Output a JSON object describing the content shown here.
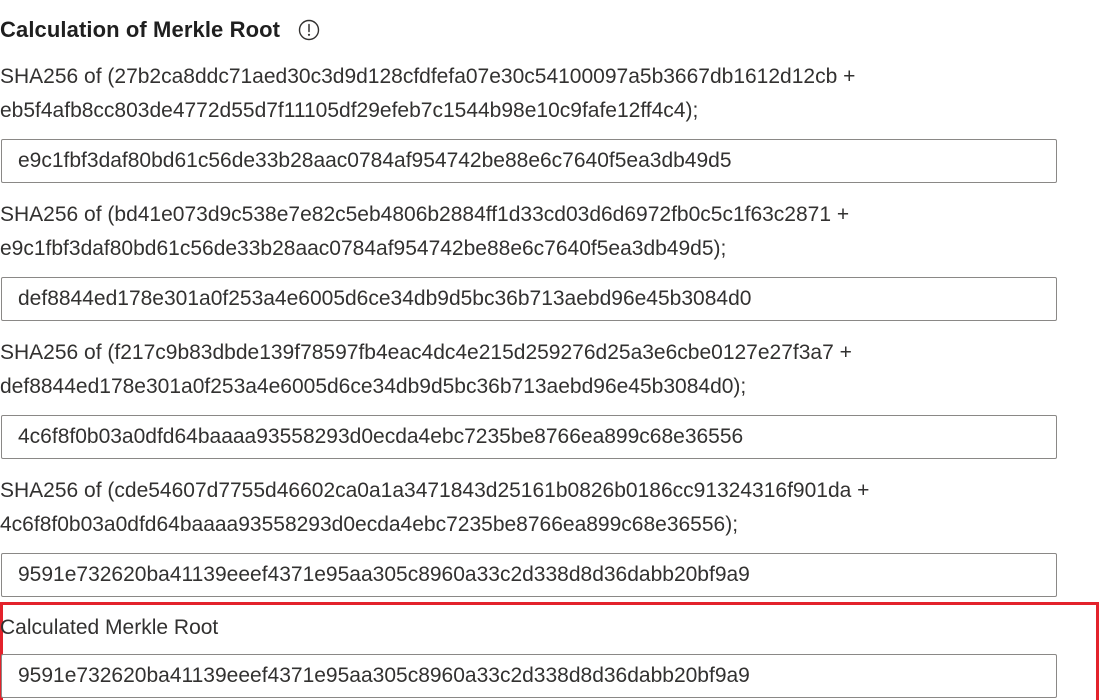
{
  "section": {
    "title": "Calculation of Merkle Root"
  },
  "steps": [
    {
      "line1": "SHA256 of (27b2ca8ddc71aed30c3d9d128cfdfefa07e30c54100097a5b3667db1612d12cb +",
      "line2": "eb5f4afb8cc803de4772d55d7f11105df29efeb7c1544b98e10c9fafe12ff4c4);",
      "result": "e9c1fbf3daf80bd61c56de33b28aac0784af954742be88e6c7640f5ea3db49d5"
    },
    {
      "line1": "SHA256 of (bd41e073d9c538e7e82c5eb4806b2884ff1d33cd03d6d6972fb0c5c1f63c2871 +",
      "line2": "e9c1fbf3daf80bd61c56de33b28aac0784af954742be88e6c7640f5ea3db49d5);",
      "result": "def8844ed178e301a0f253a4e6005d6ce34db9d5bc36b713aebd96e45b3084d0"
    },
    {
      "line1": "SHA256 of (f217c9b83dbde139f78597fb4eac4dc4e215d259276d25a3e6cbe0127e27f3a7 +",
      "line2": "def8844ed178e301a0f253a4e6005d6ce34db9d5bc36b713aebd96e45b3084d0);",
      "result": "4c6f8f0b03a0dfd64baaaa93558293d0ecda4ebc7235be8766ea899c68e36556"
    },
    {
      "line1": "SHA256 of (cde54607d7755d46602ca0a1a3471843d25161b0826b0186cc91324316f901da +",
      "line2": "4c6f8f0b03a0dfd64baaaa93558293d0ecda4ebc7235be8766ea899c68e36556);",
      "result": "9591e732620ba41139eeef4371e95aa305c8960a33c2d338d8d36dabb20bf9a9"
    }
  ],
  "merkle_root": {
    "label": "Calculated Merkle Root",
    "value": "9591e732620ba41139eeef4371e95aa305c8960a33c2d338d8d36dabb20bf9a9"
  },
  "colors": {
    "highlight_border": "#e3222b",
    "field_border": "#8a8886",
    "text": "#323130"
  }
}
